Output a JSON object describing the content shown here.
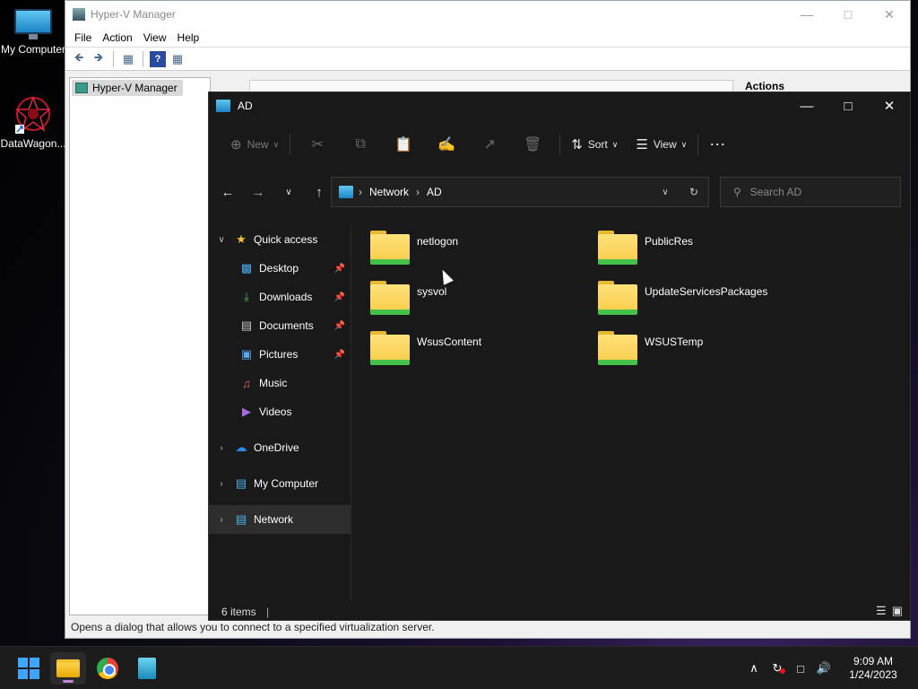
{
  "desktop": {
    "icons": [
      {
        "label": "My Computer"
      },
      {
        "label": "DataWagon..."
      }
    ]
  },
  "hyperv": {
    "title": "Hyper-V Manager",
    "menu": [
      "File",
      "Action",
      "View",
      "Help"
    ],
    "tree_root": "Hyper-V Manager",
    "actions_header": "Actions",
    "status": "Opens a dialog that allows you to connect to a specified virtualization server."
  },
  "explorer": {
    "title": "AD",
    "commands": {
      "new": "New",
      "sort": "Sort",
      "view": "View"
    },
    "breadcrumb": [
      "Network",
      "AD"
    ],
    "search_placeholder": "Search AD",
    "sidebar": {
      "quick_access": "Quick access",
      "quick_items": [
        {
          "label": "Desktop",
          "icon": "desktop-icon",
          "pinned": true
        },
        {
          "label": "Downloads",
          "icon": "download-icon",
          "pinned": true
        },
        {
          "label": "Documents",
          "icon": "document-icon",
          "pinned": true
        },
        {
          "label": "Pictures",
          "icon": "picture-icon",
          "pinned": true
        },
        {
          "label": "Music",
          "icon": "music-icon",
          "pinned": false
        },
        {
          "label": "Videos",
          "icon": "video-icon",
          "pinned": false
        }
      ],
      "roots": [
        {
          "label": "OneDrive",
          "icon": "cloud-icon"
        },
        {
          "label": "My Computer",
          "icon": "computer-icon"
        },
        {
          "label": "Network",
          "icon": "network-icon",
          "selected": true
        }
      ]
    },
    "files": [
      {
        "name": "netlogon"
      },
      {
        "name": "PublicRes"
      },
      {
        "name": "sysvol"
      },
      {
        "name": "UpdateServicesPackages"
      },
      {
        "name": "WsusContent"
      },
      {
        "name": "WSUSTemp"
      }
    ],
    "status": "6 items"
  },
  "taskbar": {
    "time": "9:09 AM",
    "date": "1/24/2023"
  },
  "colors": {
    "explorer_bg": "#191919",
    "folder_yellow": "#f8cc4a",
    "share_green": "#44c14a",
    "accent": "#3ea6ff"
  }
}
